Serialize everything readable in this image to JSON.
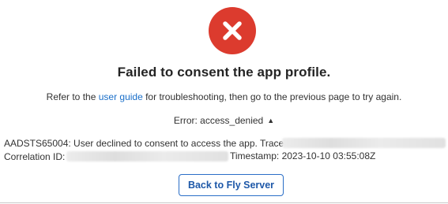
{
  "icon": "close-icon",
  "colors": {
    "error": "#dc3b2e",
    "link": "#1a6fc9",
    "button_border": "#2a6ec7"
  },
  "title": "Failed to consent the app profile.",
  "help": {
    "prefix": "Refer to the ",
    "link": "user guide",
    "suffix": " for troubleshooting, then go to the previous page to try again."
  },
  "error": {
    "label": "Error: access_denied",
    "chevron": "chevron-up-icon"
  },
  "details": {
    "line1": "AADSTS65004: User declined to consent to access the app. Trace ID:",
    "correlation_label": "Correlation ID:",
    "timestamp": "Timestamp: 2023-10-10 03:55:08Z"
  },
  "back_button": "Back to Fly Server"
}
